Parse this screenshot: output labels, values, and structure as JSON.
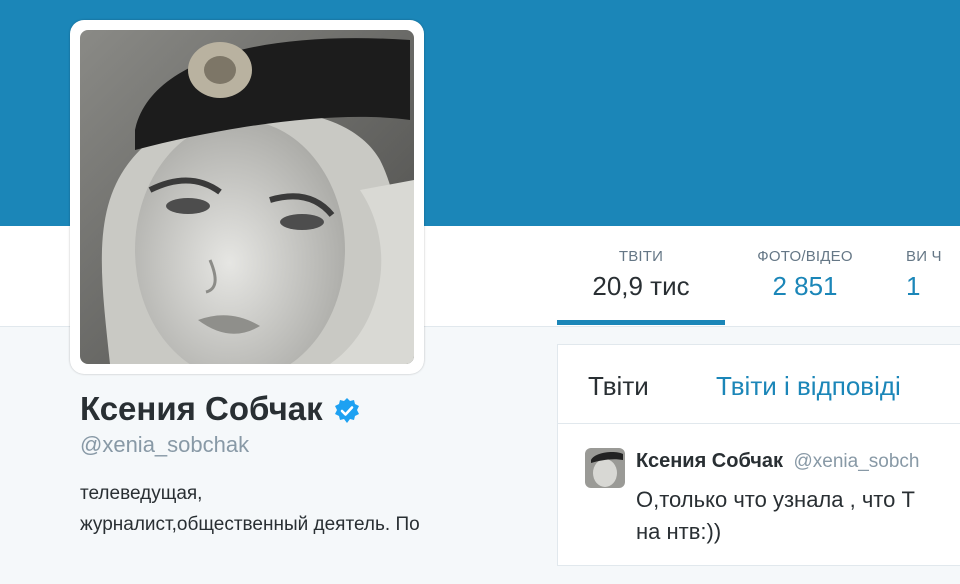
{
  "colors": {
    "accent": "#1b86b8",
    "text": "#292f33",
    "muted": "#8899a6",
    "verified": "#1da1f2"
  },
  "profile": {
    "name": "Ксения Собчак",
    "screen_name": "@xenia_sobchak",
    "bio_line1": "телеведущая,",
    "bio_line2": "журналист,общественный деятель. По",
    "avatar_icon": "profile-photo",
    "verified_icon": "verified-badge-icon"
  },
  "stats": [
    {
      "label": "ТВІТИ",
      "value": "20,9 тис"
    },
    {
      "label": "ФОТО/ВІДЕО",
      "value": "2 851"
    },
    {
      "label": "ВИ Ч",
      "value": "1"
    }
  ],
  "tabs": [
    {
      "label": "Твіти"
    },
    {
      "label": "Твіти і відповіді"
    }
  ],
  "tweet": {
    "name": "Ксения Собчак",
    "handle": "@xenia_sobch",
    "text_line1": "О,только что узнала , что  Т",
    "text_line2": "на нтв:))"
  }
}
